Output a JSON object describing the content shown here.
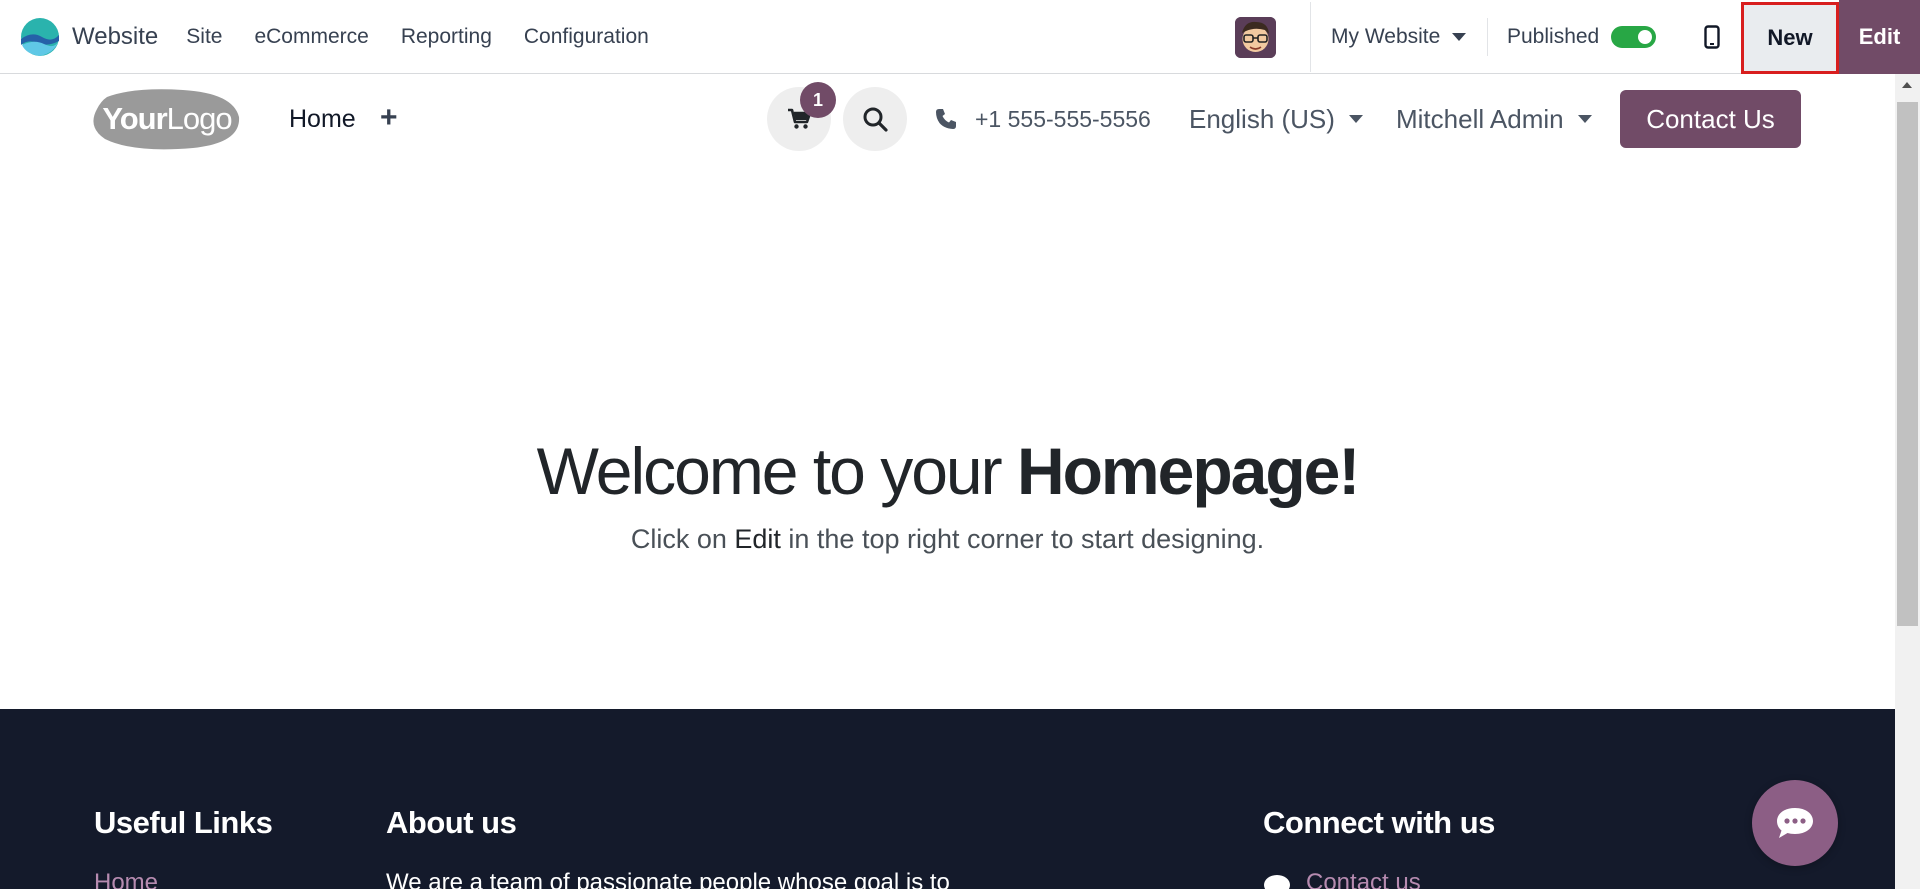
{
  "adminbar": {
    "app_name": "Website",
    "menu": [
      "Site",
      "eCommerce",
      "Reporting",
      "Configuration"
    ],
    "website_switcher": "My Website",
    "published_label": "Published",
    "published": true,
    "new_label": "New",
    "edit_label": "Edit"
  },
  "header": {
    "logo_text_a": "Your",
    "logo_text_b": "Logo",
    "nav_home": "Home",
    "nav_add": "+",
    "cart_count": "1",
    "phone": "+1 555-555-5556",
    "language": "English (US)",
    "user": "Mitchell Admin",
    "contact_label": "Contact Us"
  },
  "hero": {
    "title_plain": "Welcome to your ",
    "title_bold": "Homepage!",
    "subtitle_before": "Click on ",
    "subtitle_edit": "Edit",
    "subtitle_after": " in the top right corner to start designing."
  },
  "footer": {
    "useful_links_title": "Useful Links",
    "useful_links_first": "Home",
    "about_title": "About us",
    "about_text": "We are a team of passionate people whose goal is to",
    "connect_title": "Connect with us",
    "connect_first": "Contact us"
  },
  "colors": {
    "brand": "#714b67",
    "toggle_on": "#28a745",
    "footer_bg": "#141a2b",
    "highlight": "#d81e1e"
  },
  "icons": [
    "odoo-website-icon",
    "avatar",
    "chevron-down-icon",
    "mobile-preview-icon",
    "cart-icon",
    "search-icon",
    "phone-icon",
    "chat-icon"
  ]
}
